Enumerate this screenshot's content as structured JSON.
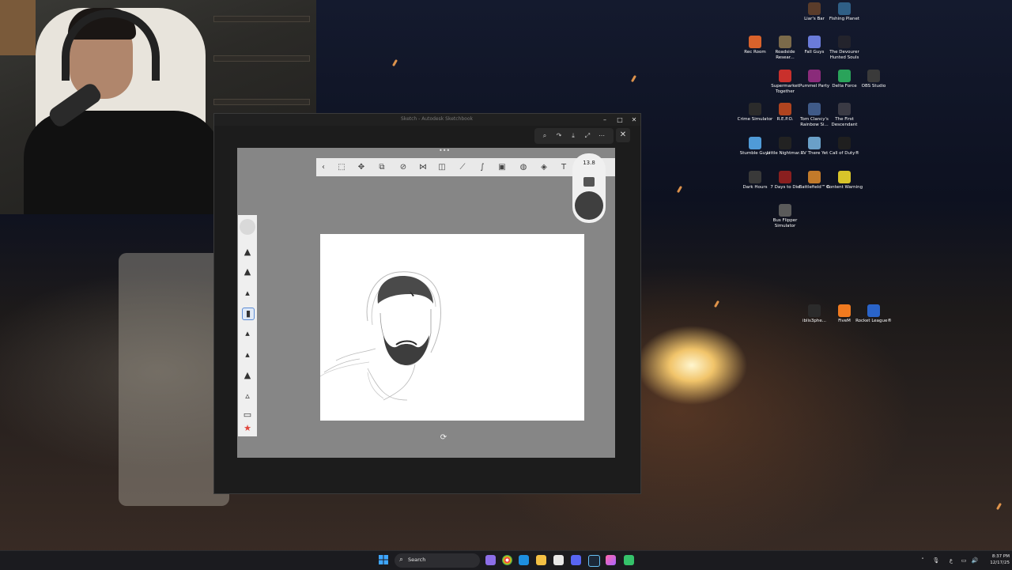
{
  "desktop": {
    "icons": [
      {
        "id": "liars-bar",
        "label": "Liar's Bar",
        "color": "#5a3c2a"
      },
      {
        "id": "fishing-planet",
        "label": "Fishing Planet",
        "color": "#2f5f86"
      },
      {
        "id": "rec-room",
        "label": "Rec Room",
        "color": "#d9622b"
      },
      {
        "id": "roadside-research",
        "label": "Roadside Resear...",
        "color": "#7b6a4a"
      },
      {
        "id": "fall-guys",
        "label": "Fall Guys",
        "color": "#6a7bd9"
      },
      {
        "id": "the-devourer",
        "label": "The Devourer Hunted Souls",
        "color": "#23232c"
      },
      {
        "id": "supermarket-together",
        "label": "Supermarket Together",
        "color": "#c9302c"
      },
      {
        "id": "pummel-party",
        "label": "Pummel Party",
        "color": "#8a2b7a"
      },
      {
        "id": "delta-force",
        "label": "Delta Force",
        "color": "#2aa35a"
      },
      {
        "id": "obs-studio",
        "label": "OBS Studio",
        "color": "#3a3a3a"
      },
      {
        "id": "crime-simulator",
        "label": "Crime Simulator",
        "color": "#2b2b2b"
      },
      {
        "id": "repo",
        "label": "R.E.P.O.",
        "color": "#b0441f"
      },
      {
        "id": "rainbow-six",
        "label": "Tom Clancy's Rainbow Si...",
        "color": "#3f5a88"
      },
      {
        "id": "the-first-descendant",
        "label": "The First Descendant",
        "color": "#3a3a44"
      },
      {
        "id": "stumble-guys",
        "label": "Stumble Guys",
        "color": "#4f9bd8"
      },
      {
        "id": "little-nightmares",
        "label": "Little Nightmar...",
        "color": "#222222"
      },
      {
        "id": "rv-there-yet",
        "label": "RV There Yet",
        "color": "#6aa0c8"
      },
      {
        "id": "call-of-duty",
        "label": "Call of Duty®",
        "color": "#1f1f1f"
      },
      {
        "id": "dark-hours",
        "label": "Dark Hours",
        "color": "#393939"
      },
      {
        "id": "7-days-to-die",
        "label": "7 Days to Die",
        "color": "#8a1f1f"
      },
      {
        "id": "battlefield-6",
        "label": "Battlefield™ 6",
        "color": "#c27a2a"
      },
      {
        "id": "content-warning",
        "label": "Content Warning",
        "color": "#d8c42a"
      },
      {
        "id": "bus-flipper",
        "label": "Bus Flipper Simulator",
        "color": "#5a5a5a"
      },
      {
        "id": "iblis3phe",
        "label": "iblis3phe...",
        "color": "#2b2b2b"
      },
      {
        "id": "fivem",
        "label": "FiveM",
        "color": "#f07a1f"
      },
      {
        "id": "rocket-league",
        "label": "Rocket League®",
        "color": "#2a64c9"
      }
    ]
  },
  "app": {
    "window_title": "Sketch - Autodesk Sketchbook",
    "brush_size": "13.8",
    "colors": {
      "toolbar_bg": "#e9e9e9",
      "canvas_bg": "#868686",
      "paper": "#ffffff",
      "accent": "#5b8bd4",
      "swatch": "#3f3f3f"
    },
    "toolbar_icons": [
      "select-icon",
      "transform-icon",
      "crop-icon",
      "symmetry-icon",
      "distort-icon",
      "lasso-icon",
      "ruler-icon",
      "curve-icon",
      "image-icon",
      "perspective-icon",
      "guide-icon",
      "text-icon"
    ],
    "palette_tools": [
      "pencil-icon",
      "marker-icon",
      "brush-icon",
      "airbrush-icon",
      "pen-icon",
      "ink-icon",
      "chisel-icon",
      "eraser-icon",
      "smudge-icon",
      "favorite-star-icon"
    ]
  },
  "taskbar": {
    "search_placeholder": "Search",
    "time": "8:37 PM",
    "date": "12/17/25"
  }
}
